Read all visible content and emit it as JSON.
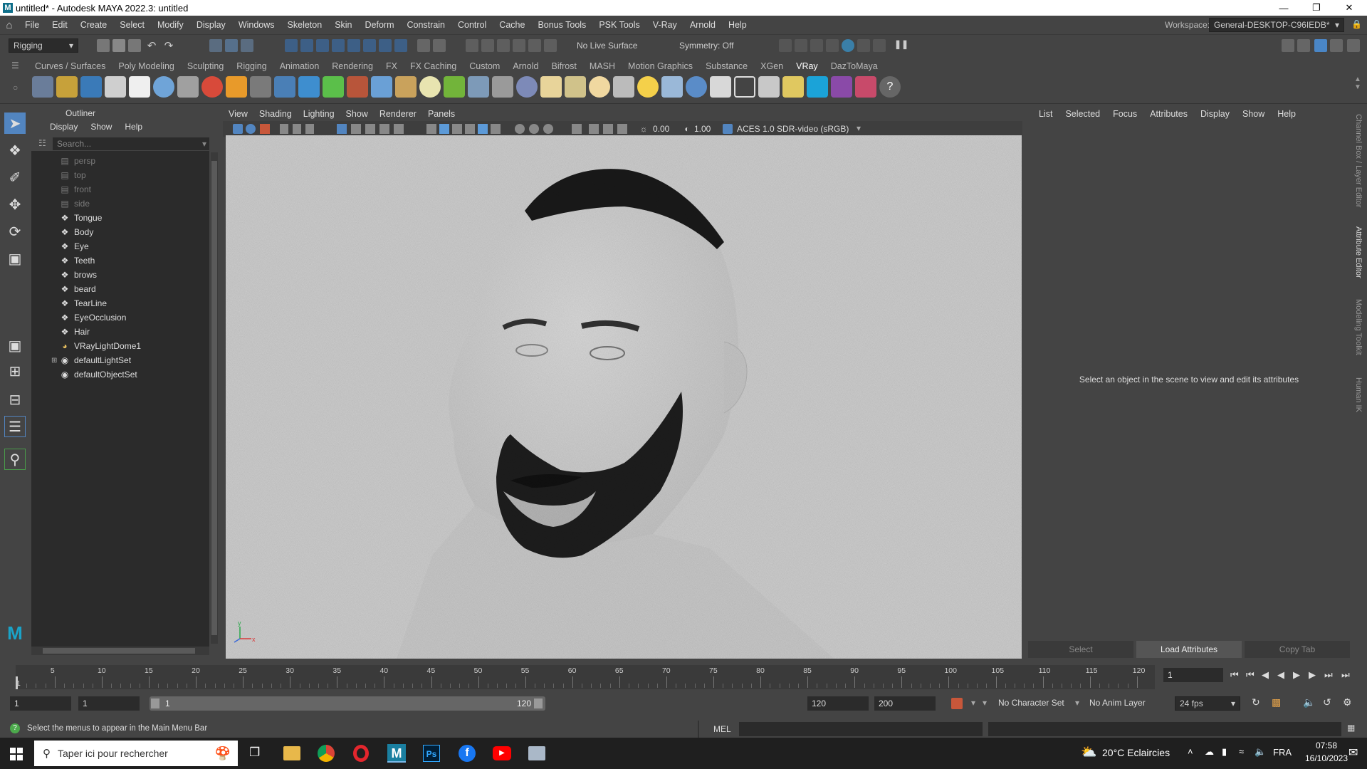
{
  "window": {
    "title": "untitled* - Autodesk MAYA 2022.3: untitled"
  },
  "menu": [
    "File",
    "Edit",
    "Create",
    "Select",
    "Modify",
    "Display",
    "Windows",
    "Skeleton",
    "Skin",
    "Deform",
    "Constrain",
    "Control",
    "Cache",
    "Bonus Tools",
    "PSK Tools",
    "V-Ray",
    "Arnold",
    "Help"
  ],
  "statusline": {
    "mode": "Rigging",
    "live_surface": "No Live Surface",
    "symmetry": "Symmetry: Off",
    "workspace_label": "Workspace:",
    "workspace_value": "General-DESKTOP-C96IEDB*"
  },
  "shelf_tabs": [
    "Curves / Surfaces",
    "Poly Modeling",
    "Sculpting",
    "Rigging",
    "Animation",
    "Rendering",
    "FX",
    "FX Caching",
    "Custom",
    "Arnold",
    "Bifrost",
    "MASH",
    "Motion Graphics",
    "Substance",
    "XGen",
    "VRay",
    "DazToMaya"
  ],
  "outliner": {
    "title": "Outliner",
    "menu": [
      "Display",
      "Show",
      "Help"
    ],
    "search_placeholder": "Search...",
    "items": [
      {
        "label": "persp",
        "icon": "camera-icon",
        "dim": true
      },
      {
        "label": "top",
        "icon": "camera-icon",
        "dim": true
      },
      {
        "label": "front",
        "icon": "camera-icon",
        "dim": true
      },
      {
        "label": "side",
        "icon": "camera-icon",
        "dim": true
      },
      {
        "label": "Tongue",
        "icon": "mesh-icon",
        "dim": false
      },
      {
        "label": "Body",
        "icon": "mesh-icon",
        "dim": false
      },
      {
        "label": "Eye",
        "icon": "mesh-icon",
        "dim": false
      },
      {
        "label": "Teeth",
        "icon": "mesh-icon",
        "dim": false
      },
      {
        "label": "brows",
        "icon": "mesh-icon",
        "dim": false
      },
      {
        "label": "beard",
        "icon": "mesh-icon",
        "dim": false
      },
      {
        "label": "TearLine",
        "icon": "mesh-icon",
        "dim": false
      },
      {
        "label": "EyeOcclusion",
        "icon": "mesh-icon",
        "dim": false
      },
      {
        "label": "Hair",
        "icon": "mesh-icon",
        "dim": false
      },
      {
        "label": "VRayLightDome1",
        "icon": "dome-light-icon",
        "dim": false
      },
      {
        "label": "defaultLightSet",
        "icon": "set-icon",
        "dim": false
      },
      {
        "label": "defaultObjectSet",
        "icon": "set-icon",
        "dim": false
      }
    ]
  },
  "viewport": {
    "menu": [
      "View",
      "Shading",
      "Lighting",
      "Show",
      "Renderer",
      "Panels"
    ],
    "exposure": "0.00",
    "gamma": "1.00",
    "color_space": "ACES 1.0 SDR-video (sRGB)",
    "axis_labels": {
      "y": "y",
      "x": "x"
    }
  },
  "attribute_editor": {
    "menu": [
      "List",
      "Selected",
      "Focus",
      "Attributes",
      "Display",
      "Show",
      "Help"
    ],
    "message": "Select an object in the scene to view and edit its attributes",
    "buttons": [
      "Select",
      "Load Attributes",
      "Copy Tab"
    ]
  },
  "side_tabs": [
    "Channel Box / Layer Editor",
    "Attribute Editor",
    "Modeling Toolkit",
    "Human IK"
  ],
  "time_slider": {
    "ticks": [
      "5",
      "10",
      "15",
      "20",
      "25",
      "30",
      "35",
      "40",
      "45",
      "50",
      "55",
      "60",
      "65",
      "70",
      "75",
      "80",
      "85",
      "90",
      "95",
      "100",
      "105",
      "110",
      "115",
      "120"
    ],
    "current_frame": "1",
    "start_label": "1"
  },
  "range": {
    "start": "1",
    "inner_start": "1",
    "slider_start": "1",
    "slider_end": "120",
    "end": "120",
    "anim_end": "200",
    "character_set": "No Character Set",
    "anim_layer": "No Anim Layer",
    "fps": "24 fps"
  },
  "command_line": {
    "help_text": "Select the menus to appear in the Main Menu Bar",
    "language": "MEL"
  },
  "taskbar": {
    "search_placeholder": "Taper ici pour rechercher",
    "weather": "20°C Eclaircies",
    "language": "FRA",
    "time": "07:58",
    "date": "16/10/2023"
  }
}
